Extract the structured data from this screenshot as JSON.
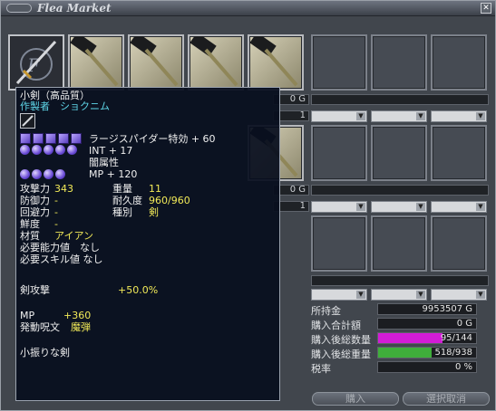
{
  "window": {
    "title": "Flea Market"
  },
  "market": {
    "slots": [
      {
        "kind": "sword"
      },
      {
        "kind": "hammer"
      },
      {
        "kind": "hammer"
      },
      {
        "kind": "hammer"
      },
      {
        "kind": "hammer"
      },
      {
        "kind": "empty"
      },
      {
        "kind": "empty"
      },
      {
        "kind": "empty"
      }
    ],
    "visible_price_fragments": [
      "0 G",
      "0 G"
    ],
    "visible_qty": [
      "1",
      "1"
    ]
  },
  "summary": {
    "rows": [
      {
        "label": "所持金",
        "value": "9953507 G"
      },
      {
        "label": "購入合計額",
        "value": "0 G"
      },
      {
        "label": "購入後総数量",
        "value": "95/144",
        "fill": 0.66,
        "color": "#d21cd6"
      },
      {
        "label": "購入後総重量",
        "value": "518/938",
        "fill": 0.55,
        "color": "#3fae3b"
      },
      {
        "label": "税率",
        "value": "0 %"
      }
    ]
  },
  "buttons": {
    "buy": "購入",
    "cancel": "選択取消"
  },
  "tooltip": {
    "name": "小剣（高品質）",
    "maker_label": "作製者",
    "maker": "ショクニム",
    "enchant1": "ラージスパイダー特効 + 60",
    "enchant2": "INT + 17",
    "enchant3": "闇属性",
    "enchant4": "MP + 120",
    "stats": [
      {
        "label": "攻撃力",
        "value": "343",
        "label2": "重量",
        "value2": "11"
      },
      {
        "label": "防御力",
        "value": "-",
        "label2": "耐久度",
        "value2": "960/960"
      },
      {
        "label": "回避力",
        "value": "-",
        "label2": "種別",
        "value2": "剣"
      },
      {
        "label": "鮮度",
        "value": "-"
      }
    ],
    "material_label": "材質",
    "material": "アイアン",
    "req_ability": "必要能力値　なし",
    "req_skill": "必要スキル値 なし",
    "sword_attack_label": "剣攻撃",
    "sword_attack_value": "+50.0%",
    "mp_label": "MP",
    "mp_value": "+360",
    "spell_label": "発動呪文",
    "spell_value": "魔弾",
    "description": "小振りな剣"
  }
}
